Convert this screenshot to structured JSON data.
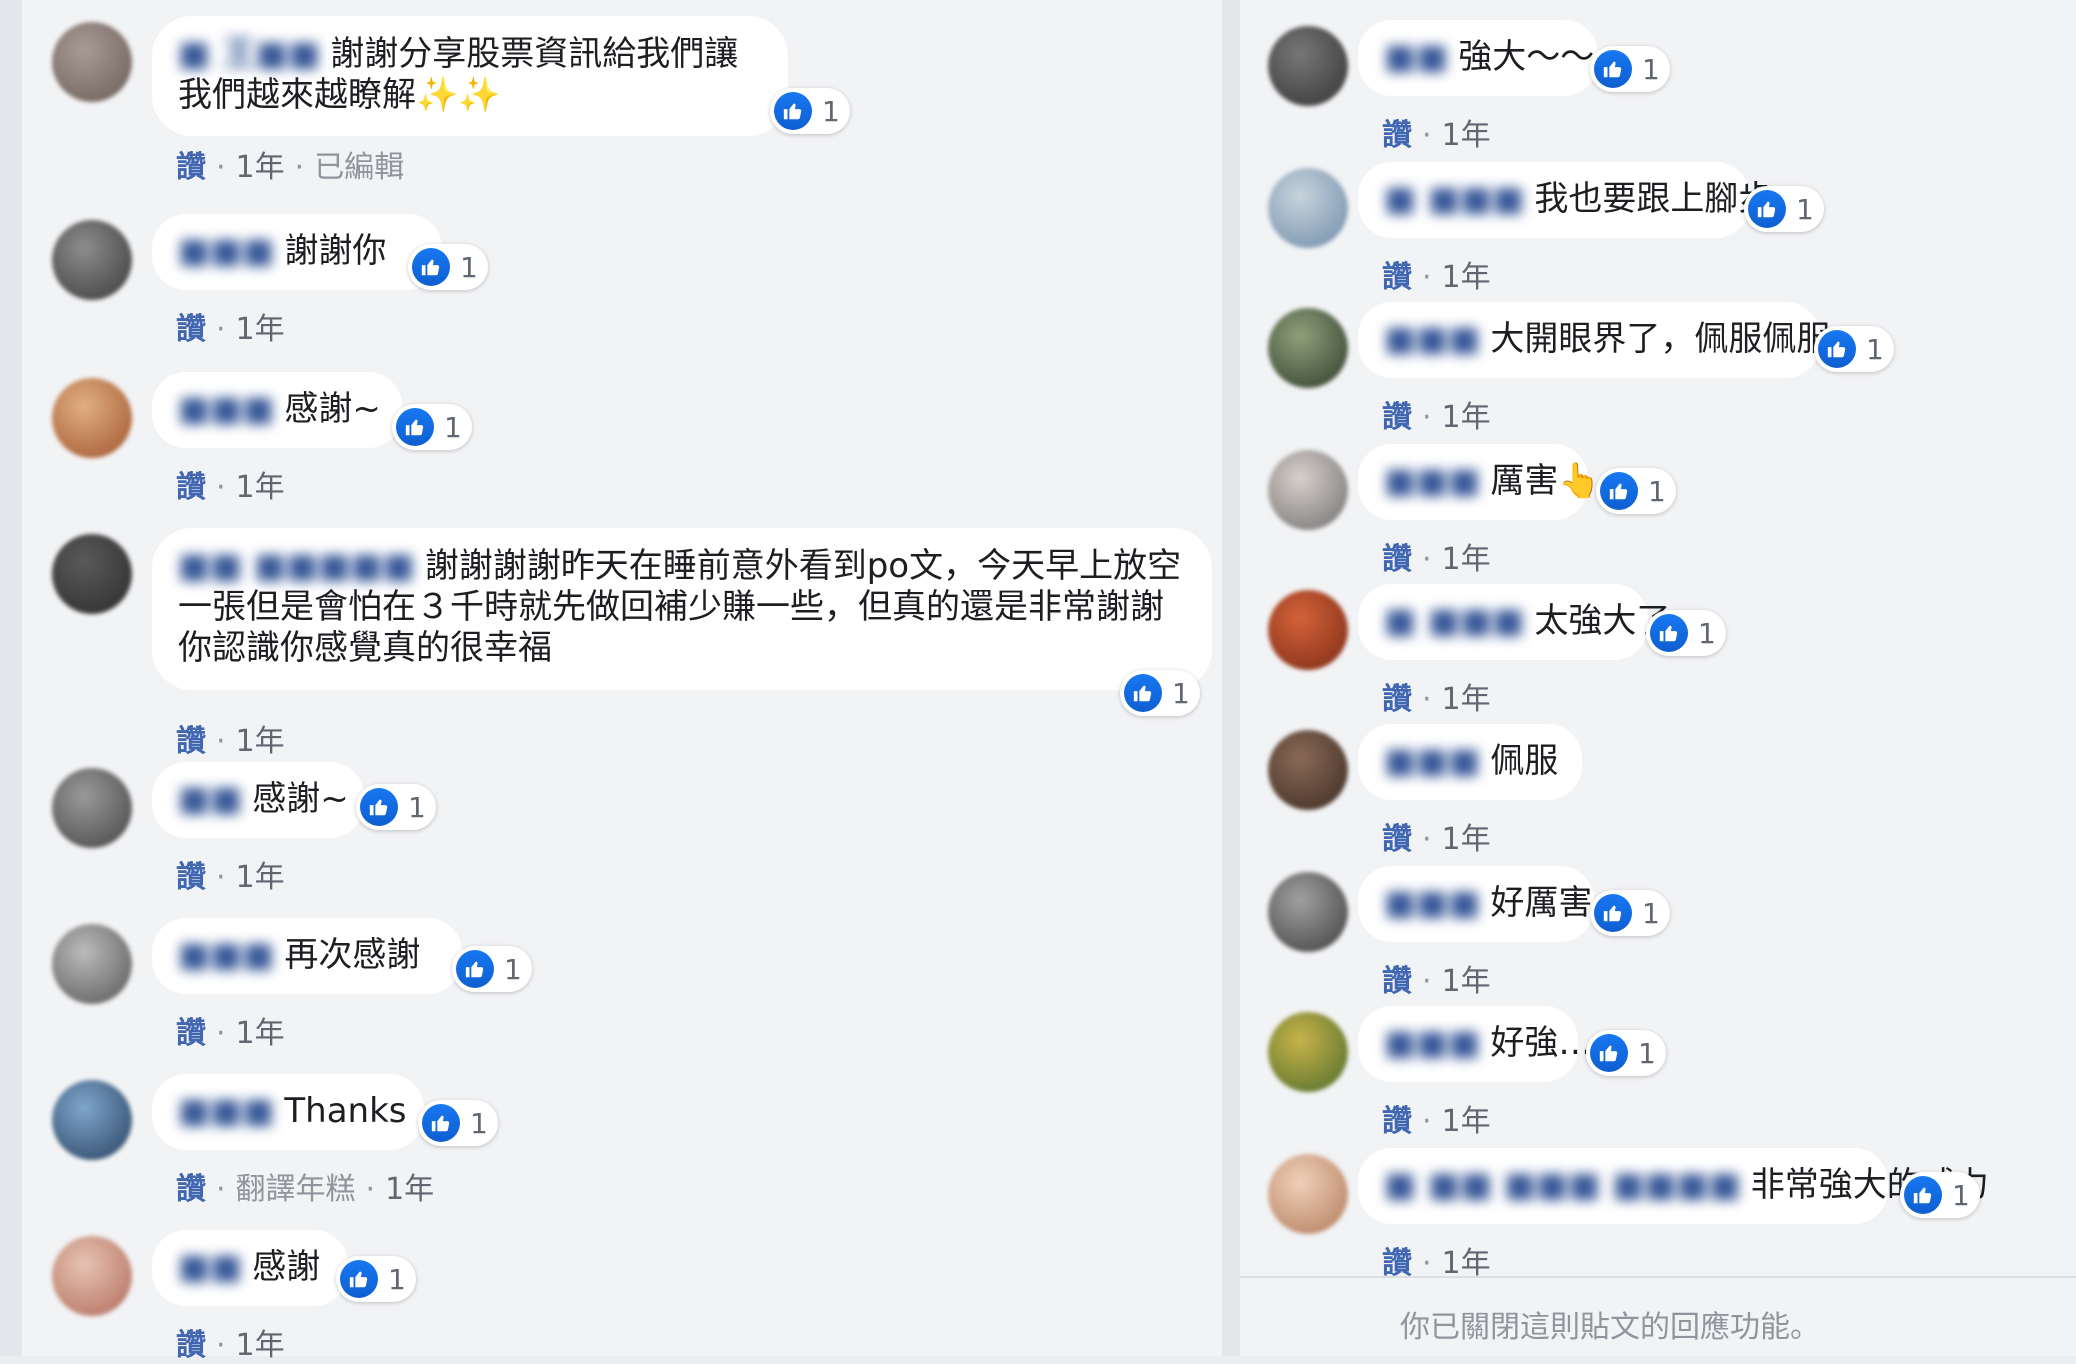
{
  "ui": {
    "like_label": "讚",
    "separator": "·",
    "reaction_count": "1",
    "colors": {
      "link": "#4267b2",
      "like_blue": "#1877f2",
      "bubble": "#ffffff",
      "background": "#f2f3f5"
    }
  },
  "left_comments": [
    {
      "author": "■ 王■■",
      "text": "謝謝分享股票資訊給我們讓我們越來越瞭解✨✨",
      "time": "1年",
      "extra": "已編輯",
      "reactions": "1"
    },
    {
      "author": "■■■",
      "text": "謝謝你",
      "time": "1年",
      "reactions": "1"
    },
    {
      "author": "■■■",
      "text": "感謝~",
      "time": "1年",
      "reactions": "1"
    },
    {
      "author": "■■ ■■■■■",
      "text": "謝謝謝謝昨天在睡前意外看到po文，今天早上放空一張但是會怕在３千時就先做回補少賺一些，但真的還是非常謝謝你認識你感覺真的很幸福",
      "time": "1年",
      "reactions": "1"
    },
    {
      "author": "■■",
      "text": "感謝~",
      "time": "1年",
      "reactions": "1"
    },
    {
      "author": "■■■",
      "text": "再次感謝",
      "time": "1年",
      "reactions": "1"
    },
    {
      "author": "■■■",
      "text": "Thanks",
      "time": "1年",
      "translate": "翻譯年糕",
      "reactions": "1"
    },
    {
      "author": "■■",
      "text": "感謝",
      "time": "1年",
      "reactions": "1"
    }
  ],
  "right_comments": [
    {
      "author": "■■",
      "text": "強大～～",
      "time": "1年",
      "reactions": "1"
    },
    {
      "author": "■ ■■■",
      "text": "我也要跟上腳步",
      "time": "1年",
      "reactions": "1"
    },
    {
      "author": "■■■",
      "text": "大開眼界了，佩服佩服",
      "time": "1年",
      "reactions": "1"
    },
    {
      "author": "■■■",
      "text": "厲害👆",
      "time": "1年",
      "reactions": "1"
    },
    {
      "author": "■ ■■■",
      "text": "太強大了",
      "time": "1年",
      "reactions": "1"
    },
    {
      "author": "■■■",
      "text": "佩服",
      "time": "1年",
      "reactions": ""
    },
    {
      "author": "■■■",
      "text": "好厲害",
      "time": "1年",
      "reactions": "1"
    },
    {
      "author": "■■■",
      "text": "好強…",
      "time": "1年",
      "reactions": "1"
    },
    {
      "author": "■ ■■ ■■■ ■■■■",
      "text": "非常強大的威力",
      "time": "1年",
      "reactions": "1"
    }
  ],
  "footer": {
    "note": "你已關閉這則貼文的回應功能。"
  }
}
